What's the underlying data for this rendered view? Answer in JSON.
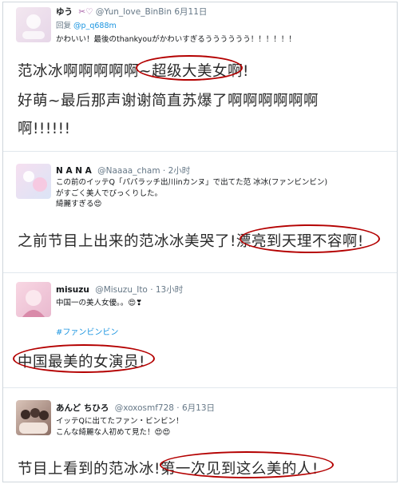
{
  "tweets": [
    {
      "name": "ゆう",
      "handle_prefix": "✂♡",
      "handle": "@Yun_love_BinBin",
      "time": "6月11日",
      "reply_label": "回复",
      "reply_to": "@p_q688m",
      "lines": [
        "かわいい！最後のthankyouがかわいすぎるうううううう！！！！！！"
      ],
      "comment_lines": [
        "范冰冰啊啊啊啊啊~超级大美女啊!",
        "好萌~最后那声谢谢简直苏爆了啊啊啊啊啊啊",
        "啊!!!!!!"
      ],
      "highlight": "超级大美女啊!"
    },
    {
      "name": "N A N A",
      "handle": "@Naaaa_cham",
      "time": "· 2小时",
      "lines": [
        "この前のイッテQ「パパラッチ出川inカンヌ」で出てた范 冰冰(ファンビンビン)",
        "がすごく美人でびっくりした。",
        "綺麗すぎる😍"
      ],
      "comment_lines": [
        "之前节目上出来的范冰冰美哭了!漂亮到天理不容啊!"
      ],
      "highlight": "漂亮到天理不容啊!"
    },
    {
      "name": "misuzu",
      "handle": "@Misuzu_Ito",
      "time": "· 13小时",
      "lines": [
        "中国一の美人女優。。😍❣"
      ],
      "hashtag": "#ファンビンビン",
      "comment_lines": [
        "中国最美的女演员!"
      ],
      "highlight": "中国最美的女演员!"
    },
    {
      "name": "あんど ちひろ",
      "handle": "@xoxosmf728",
      "time": "· 6月13日",
      "lines": [
        "イッテQに出てたファン・ビンビン！",
        "こんな綺麗な人初めて見た！😍😍"
      ],
      "comment_lines": [
        "节目上看到的范冰冰!第一次见到这么美的人!"
      ],
      "highlight": "第一次见到这么美的人!"
    }
  ],
  "colors": {
    "link": "#1b95e0",
    "ring": "#b40000",
    "muted": "#657786"
  }
}
